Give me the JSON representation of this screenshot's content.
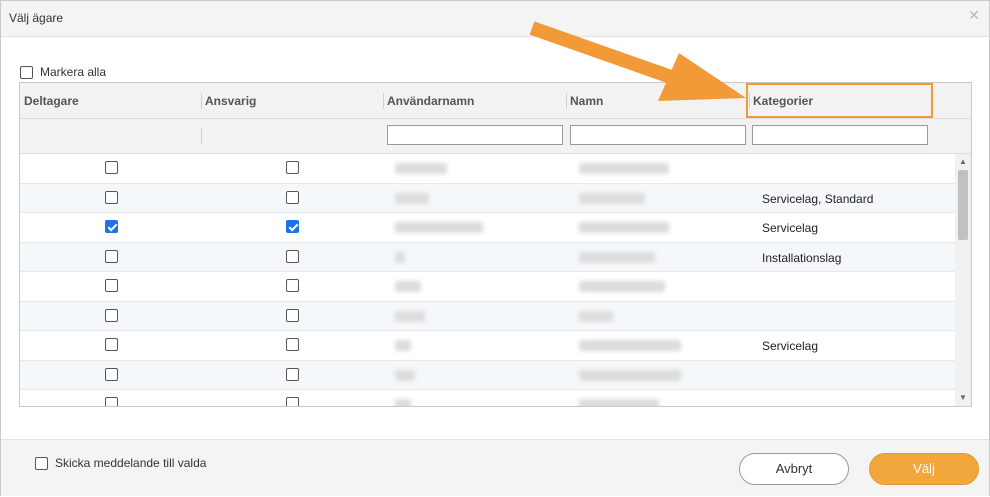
{
  "dialog": {
    "title": "Välj ägare",
    "close_icon": "close-icon"
  },
  "select_all": {
    "label": "Markera alla",
    "checked": false
  },
  "columns": {
    "deltagare": "Deltagare",
    "ansvarig": "Ansvarig",
    "anvandarnamn": "Användarnamn",
    "namn": "Namn",
    "kategorier": "Kategorier"
  },
  "filters": {
    "anvandarnamn": "",
    "namn": "",
    "kategorier": ""
  },
  "rows": [
    {
      "deltagare": false,
      "ansvarig": false,
      "kategorier": ""
    },
    {
      "deltagare": false,
      "ansvarig": false,
      "kategorier": "Servicelag, Standard"
    },
    {
      "deltagare": true,
      "ansvarig": true,
      "kategorier": "Servicelag"
    },
    {
      "deltagare": false,
      "ansvarig": false,
      "kategorier": "Installationslag"
    },
    {
      "deltagare": false,
      "ansvarig": false,
      "kategorier": ""
    },
    {
      "deltagare": false,
      "ansvarig": false,
      "kategorier": ""
    },
    {
      "deltagare": false,
      "ansvarig": false,
      "kategorier": "Servicelag"
    },
    {
      "deltagare": false,
      "ansvarig": false,
      "kategorier": ""
    },
    {
      "deltagare": false,
      "ansvarig": false,
      "kategorier": ""
    }
  ],
  "footer": {
    "notify_label": "Skicka meddelande till valda",
    "notify_checked": false,
    "cancel_label": "Avbryt",
    "ok_label": "Välj"
  },
  "colors": {
    "accent": "#f2a73d",
    "annotation": "#f29a38",
    "checkbox_checked": "#1a73e8"
  }
}
